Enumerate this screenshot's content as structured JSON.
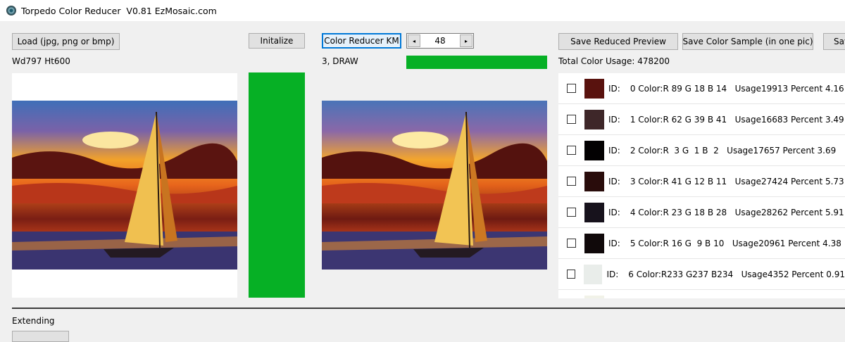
{
  "window": {
    "title": "Torpedo Color Reducer  V0.81 EzMosaic.com"
  },
  "buttons": {
    "load": "Load (jpg, png or bmp)",
    "initialize": "Initalize",
    "color_reducer": "Color Reducer KM",
    "save_preview": "Save Reduced Preview",
    "save_sample": "Save Color Sample (in one pic)",
    "save_partial": "Sav"
  },
  "spinner": {
    "value": "48",
    "left_arrow": "◂",
    "right_arrow": "▸"
  },
  "labels": {
    "dimensions": "Wd797 Ht600",
    "status": "3, DRAW",
    "total_usage": "Total Color Usage: 478200",
    "extending": "Extending"
  },
  "progress": {
    "initialize_bar": 1.0,
    "reduce_bar": 1.0
  },
  "colors": [
    {
      "id_label": "ID:",
      "text": "0 Color:R 89 G 18 B 14   Usage19913 Percent 4.16",
      "hex": "#59120e"
    },
    {
      "id_label": "ID:",
      "text": "1 Color:R 62 G 39 B 41   Usage16683 Percent 3.49",
      "hex": "#3e2729"
    },
    {
      "id_label": "ID:",
      "text": "2 Color:R  3 G  1 B  2   Usage17657 Percent 3.69",
      "hex": "#030102"
    },
    {
      "id_label": "ID:",
      "text": "3 Color:R 41 G 12 B 11   Usage27424 Percent 5.73",
      "hex": "#290c0b"
    },
    {
      "id_label": "ID:",
      "text": "4 Color:R 23 G 18 B 28   Usage28262 Percent 5.91",
      "hex": "#17121c"
    },
    {
      "id_label": "ID:",
      "text": "5 Color:R 16 G  9 B 10   Usage20961 Percent 4.38",
      "hex": "#10090a"
    },
    {
      "id_label": "ID:",
      "text": "6 Color:R233 G237 B234   Usage4352 Percent 0.91",
      "hex": "#e9edea"
    }
  ]
}
